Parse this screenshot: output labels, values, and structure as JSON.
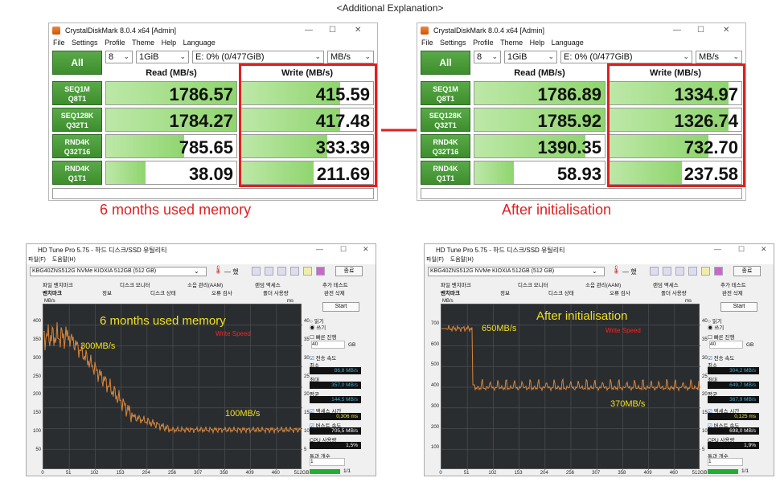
{
  "heading": "<Additional Explanation>",
  "crystaldiskmark": {
    "title": "CrystalDiskMark 8.0.4 x64 [Admin]",
    "menu": [
      "File",
      "Settings",
      "Profile",
      "Theme",
      "Help",
      "Language"
    ],
    "all_button": "All",
    "count": "8",
    "size": "1GiB",
    "drive": "E: 0% (0/477GiB)",
    "unit": "MB/s",
    "read_header": "Read (MB/s)",
    "write_header": "Write (MB/s)",
    "rows": [
      {
        "line1": "SEQ1M",
        "line2": "Q8T1"
      },
      {
        "line1": "SEQ128K",
        "line2": "Q32T1"
      },
      {
        "line1": "RND4K",
        "line2": "Q32T16"
      },
      {
        "line1": "RND4K",
        "line2": "Q1T1"
      }
    ],
    "before": {
      "caption": "6 months used memory",
      "read": [
        "1786.57",
        "1784.27",
        "785.65",
        "38.09"
      ],
      "write": [
        "415.59",
        "417.48",
        "333.39",
        "211.69"
      ],
      "read_fill": [
        1.0,
        1.0,
        0.6,
        0.3
      ],
      "write_fill": [
        0.75,
        0.75,
        0.65,
        0.55
      ]
    },
    "after": {
      "caption": "After initialisation",
      "read": [
        "1786.89",
        "1785.92",
        "1390.35",
        "58.93"
      ],
      "write": [
        "1334.97",
        "1326.74",
        "732.70",
        "237.58"
      ],
      "read_fill": [
        1.0,
        1.0,
        0.85,
        0.3
      ],
      "write_fill": [
        0.9,
        0.9,
        0.75,
        0.55
      ]
    },
    "colors": {
      "green": "#3e8e2e",
      "red": "#e02020"
    }
  },
  "hdtune": {
    "title": "HD Tune Pro 5.75 - 하드 디스크/SSD 유틸리티",
    "menu": [
      "파일(F)",
      "도움말(H)"
    ],
    "drive": "KBG40ZNS512G NVMe KIOXIA 512GB (512 GB)",
    "temp": "— 했",
    "exit_button": "종료",
    "tabs_row1": [
      "파일 벤치마크",
      "디스크 모니터",
      "소음 관리(AAM)",
      "랜덤 액세스",
      "추가 테스트"
    ],
    "tabs_row2": [
      "벤치마크",
      "정보",
      "디스크 상태",
      "오류 검사",
      "폴더 사용량",
      "완전 삭제"
    ],
    "start_button": "Start",
    "read_option": "읽기",
    "write_option": "쓰기",
    "fast_label": "빠른 진행",
    "gb_value": "40",
    "gb_unit": "GB",
    "transfer_label": "전송 속도",
    "min_label": "최소",
    "max_label": "최대",
    "avg_label": "평균",
    "access_label": "액세스 시간",
    "burst_label": "버스트 속도",
    "cpu_label": "CPU 사용량",
    "passes_label": "통과 개수",
    "passes_value": "1",
    "progress_text": "1/1",
    "chart_unit_left": "MB/s",
    "chart_unit_right": "ms",
    "write_speed_label": "Write Speed",
    "y_ticks_left": [
      "400",
      "350",
      "300",
      "250",
      "200",
      "150",
      "100",
      "50"
    ],
    "y_ticks_right": [
      "40",
      "35",
      "30",
      "25",
      "20",
      "15",
      "10",
      "5"
    ],
    "x_ticks": [
      "0",
      "51",
      "102",
      "153",
      "204",
      "256",
      "307",
      "358",
      "409",
      "460",
      "512GB"
    ],
    "before": {
      "caption": "6 months used memory",
      "annot_high": "300MB/s",
      "annot_low": "100MB/s",
      "min": "86,8 MB/s",
      "max": "357,0 MB/s",
      "avg": "144,5 MB/s",
      "access": "0,306 ms",
      "burst": "705,5 MB/s",
      "cpu": "1,5%",
      "y_max_left": 400,
      "y_ticks_left": [
        "400",
        "350",
        "300",
        "250",
        "200",
        "150",
        "100",
        "50"
      ]
    },
    "after": {
      "caption": "After initialisation",
      "annot_high": "650MB/s",
      "annot_low": "370MB/s",
      "min": "304,2 MB/s",
      "max": "649,7 MB/s",
      "avg": "367,9 MB/s",
      "access": "0,125 ms",
      "burst": "698,0 MB/s",
      "cpu": "1,9%",
      "y_max_left": 800,
      "y_ticks_left": [
        "700",
        "600",
        "500",
        "400",
        "300",
        "200",
        "100"
      ]
    }
  }
}
